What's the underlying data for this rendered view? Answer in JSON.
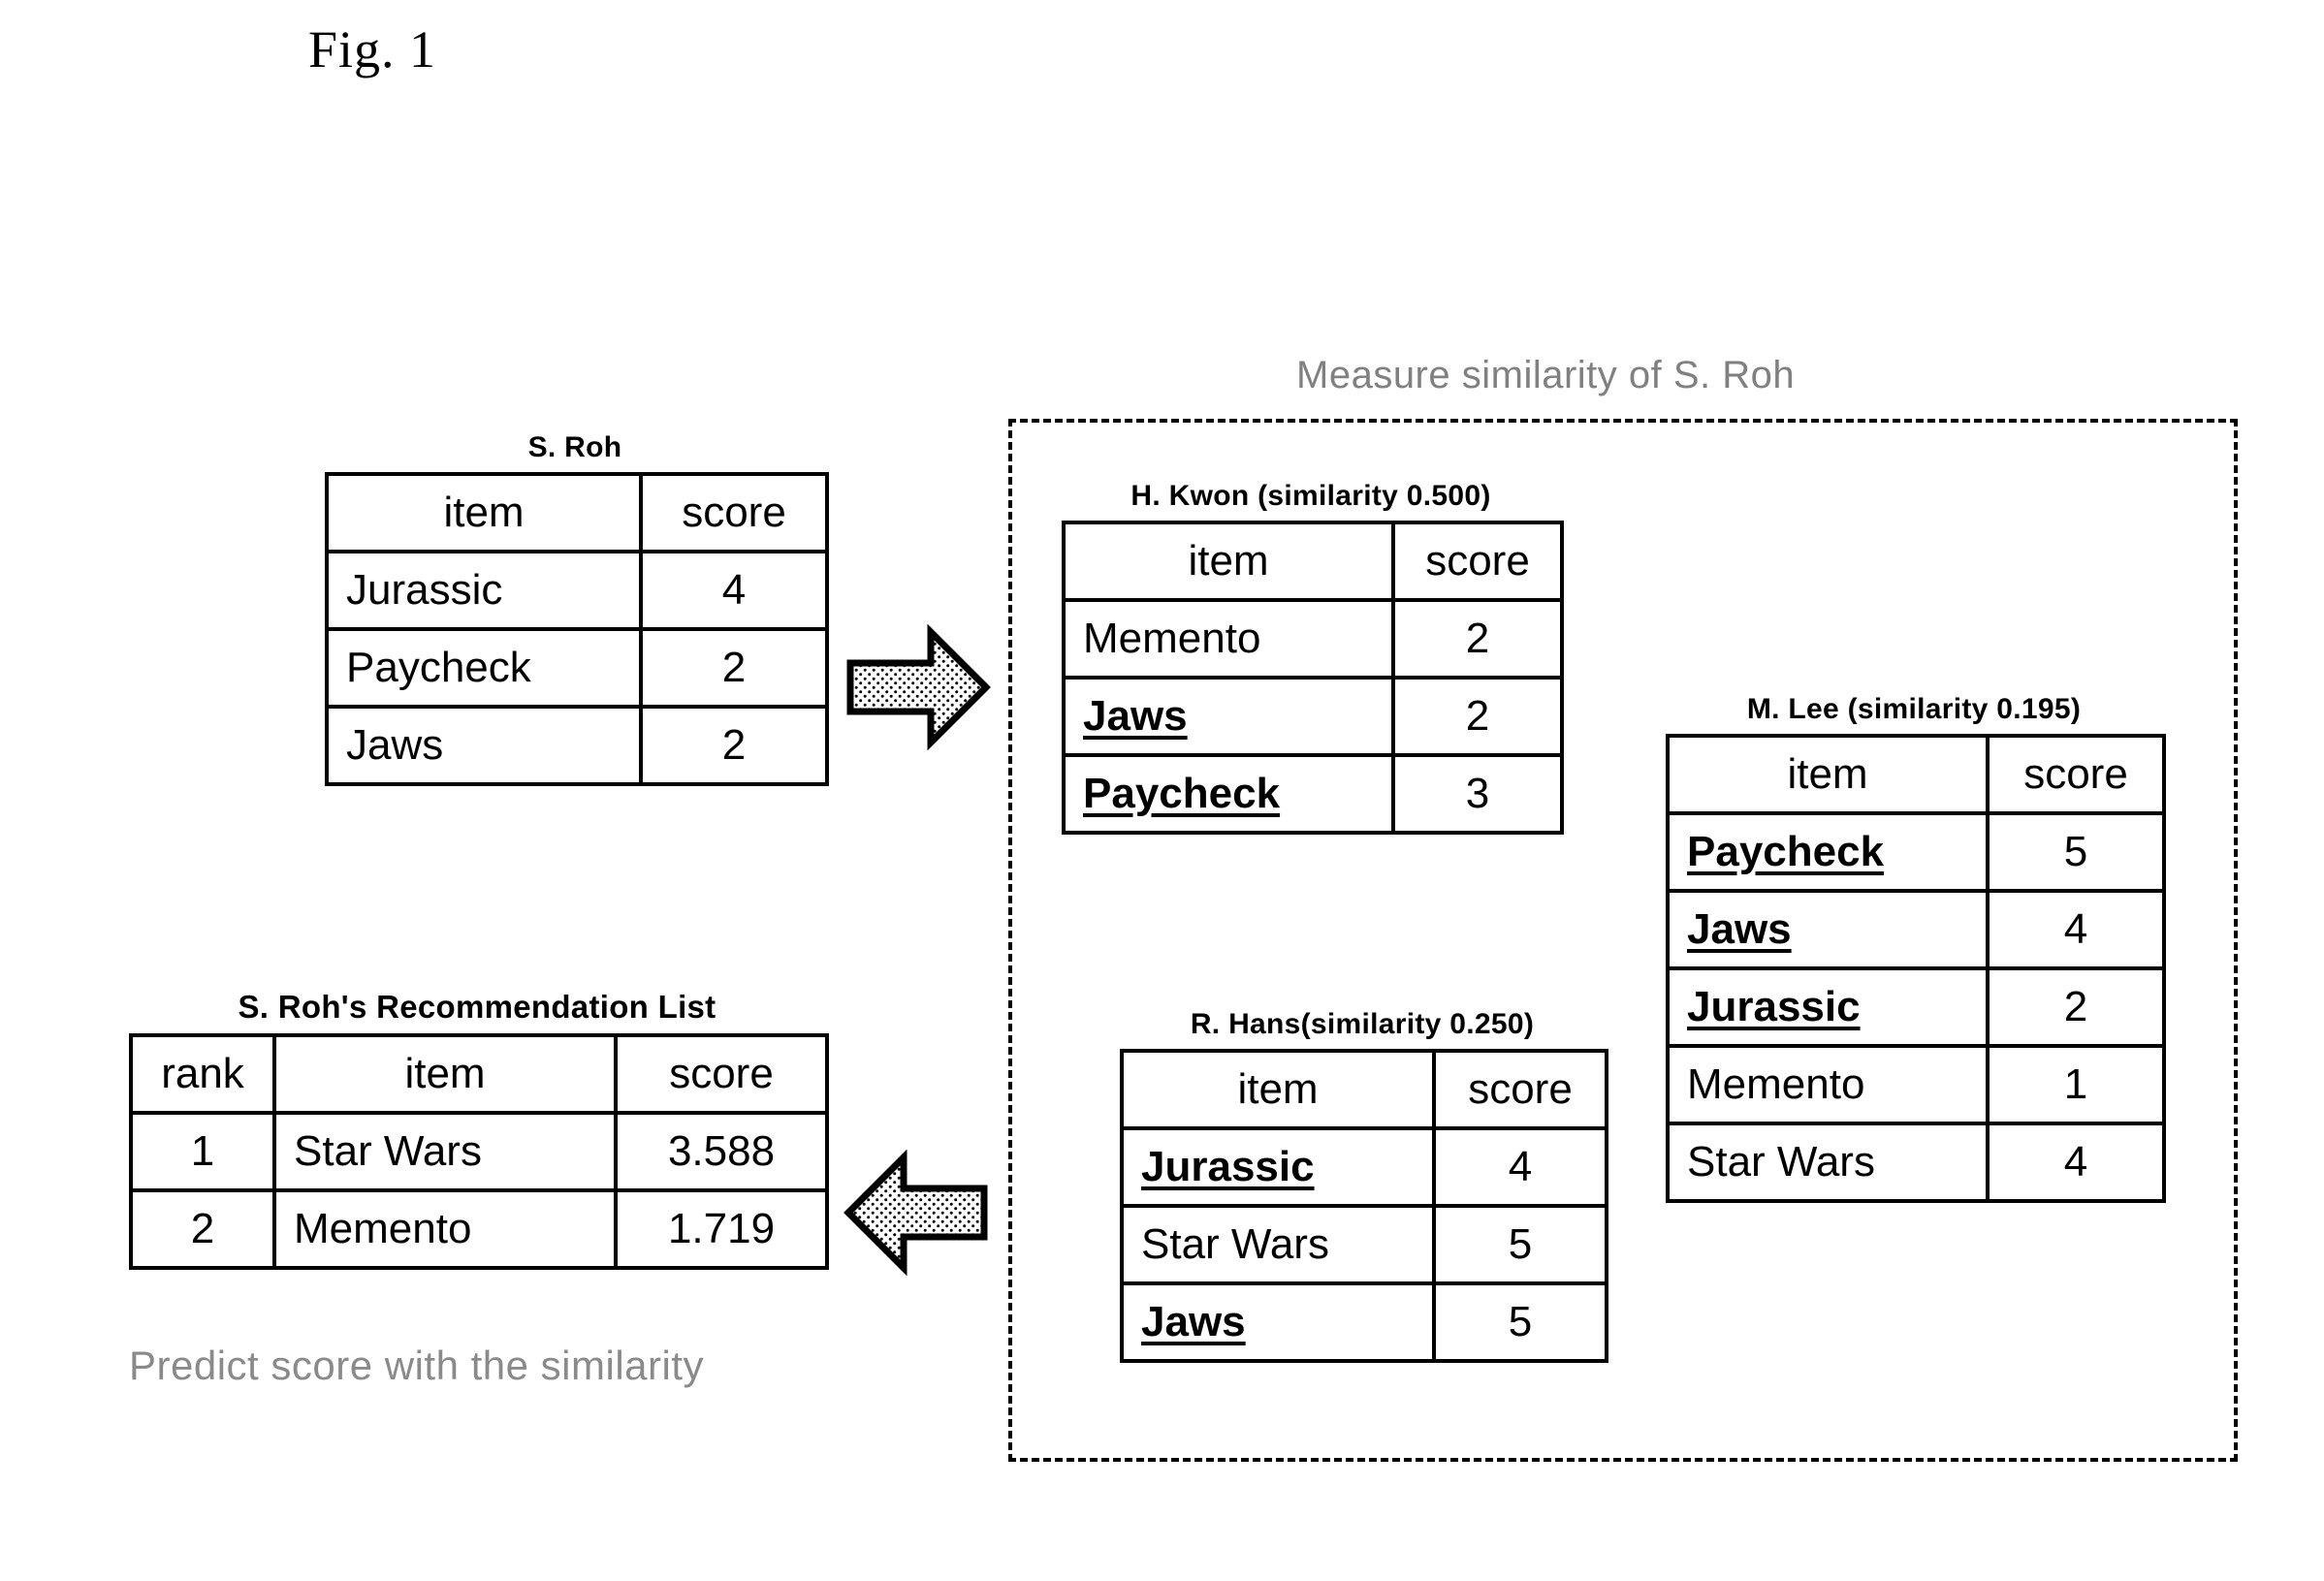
{
  "figure": {
    "label": "Fig. 1"
  },
  "similarity_group": {
    "title": "Measure similarity of S. Roh"
  },
  "captions": {
    "predict": "Predict score with the similarity"
  },
  "columns": {
    "item": "item",
    "score": "score",
    "rank": "rank"
  },
  "tables": {
    "s_roh": {
      "title": "S. Roh",
      "headers": [
        "item",
        "score"
      ],
      "rows": [
        {
          "item": "Jurassic",
          "score": "4",
          "highlight": false
        },
        {
          "item": "Paycheck",
          "score": "2",
          "highlight": false
        },
        {
          "item": "Jaws",
          "score": "2",
          "highlight": false
        }
      ]
    },
    "h_kwon": {
      "title": "H. Kwon (similarity 0.500)",
      "similarity": "0.500",
      "headers": [
        "item",
        "score"
      ],
      "rows": [
        {
          "item": "Memento",
          "score": "2",
          "highlight": false
        },
        {
          "item": "Jaws",
          "score": "2",
          "highlight": true
        },
        {
          "item": "Paycheck",
          "score": "3",
          "highlight": true
        }
      ]
    },
    "r_hans": {
      "title": "R. Hans(similarity 0.250)",
      "similarity": "0.250",
      "headers": [
        "item",
        "score"
      ],
      "rows": [
        {
          "item": "Jurassic",
          "score": "4",
          "highlight": true
        },
        {
          "item": "Star Wars",
          "score": "5",
          "highlight": false
        },
        {
          "item": "Jaws",
          "score": "5",
          "highlight": true
        }
      ]
    },
    "m_lee": {
      "title": "M. Lee (similarity 0.195)",
      "similarity": "0.195",
      "headers": [
        "item",
        "score"
      ],
      "rows": [
        {
          "item": "Paycheck",
          "score": "5",
          "highlight": true
        },
        {
          "item": "Jaws",
          "score": "4",
          "highlight": true
        },
        {
          "item": "Jurassic",
          "score": "2",
          "highlight": true
        },
        {
          "item": "Memento",
          "score": "1",
          "highlight": false
        },
        {
          "item": "Star Wars",
          "score": "4",
          "highlight": false
        }
      ]
    },
    "recommendation": {
      "title": "S. Roh's Recommendation List",
      "headers": [
        "rank",
        "item",
        "score"
      ],
      "rows": [
        {
          "rank": "1",
          "item": "Star Wars",
          "score": "3.588"
        },
        {
          "rank": "2",
          "item": "Memento",
          "score": "1.719"
        }
      ]
    }
  },
  "arrows": {
    "right": "arrow-right",
    "left": "arrow-left"
  }
}
